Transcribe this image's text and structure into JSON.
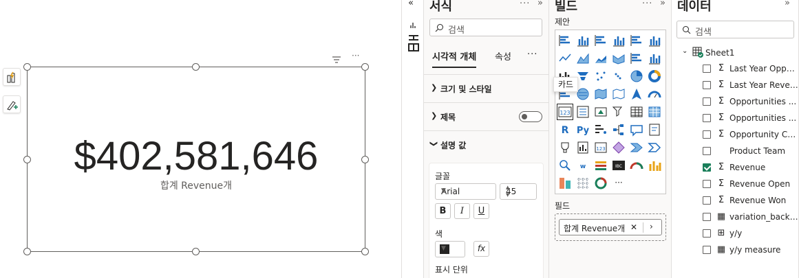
{
  "canvas": {
    "card": {
      "value": "$402,581,646",
      "label": "합계 Revenue개"
    }
  },
  "format_pane": {
    "title": "서식",
    "search_placeholder": "검색",
    "tabs": [
      "시각적 개체",
      "속성",
      "···"
    ],
    "sections": [
      {
        "label": "크기 및 스타일",
        "expanded": false
      },
      {
        "label": "제목",
        "expanded": false,
        "toggle": "off"
      },
      {
        "label": "설명 값",
        "expanded": true
      }
    ],
    "callout": {
      "font_label": "글꼴",
      "font_family": "Arial",
      "font_size": "45",
      "bold": "B",
      "italic": "I",
      "underline": "U",
      "color_label": "색",
      "fx": "fx",
      "display_units_label": "표시 단위",
      "color_value": "#252423"
    }
  },
  "build_pane": {
    "title": "빌드",
    "suggest_label": "제안",
    "tooltip": "카드",
    "fields_label": "필드",
    "field_pill": "합계 Revenue개",
    "field_remove": "✕",
    "field_expand": "›"
  },
  "data_pane": {
    "title": "데이터",
    "search_placeholder": "검색",
    "table": "Sheet1",
    "fields": [
      {
        "name": "Last Year Oppor...",
        "icon": "sigma",
        "checked": false
      },
      {
        "name": "Last Year Reven...",
        "icon": "sigma",
        "checked": false
      },
      {
        "name": "Opportunities ...",
        "icon": "sigma",
        "checked": false
      },
      {
        "name": "Opportunities ...",
        "icon": "sigma",
        "checked": false
      },
      {
        "name": "Opportunity Co...",
        "icon": "sigma",
        "checked": false
      },
      {
        "name": "Product Team",
        "icon": "none",
        "checked": false
      },
      {
        "name": "Revenue",
        "icon": "sigma",
        "checked": true
      },
      {
        "name": "Revenue Open",
        "icon": "sigma",
        "checked": false
      },
      {
        "name": "Revenue Won",
        "icon": "sigma",
        "checked": false
      },
      {
        "name": "variation_backg...",
        "icon": "calculator",
        "checked": false
      },
      {
        "name": "y/y",
        "icon": "measure-table",
        "checked": false
      },
      {
        "name": "y/y measure",
        "icon": "calculator",
        "checked": false
      }
    ]
  },
  "colors": {
    "accent_green": "#1a7f5a",
    "text": "#252423",
    "pane_bg": "#faf9f8"
  }
}
